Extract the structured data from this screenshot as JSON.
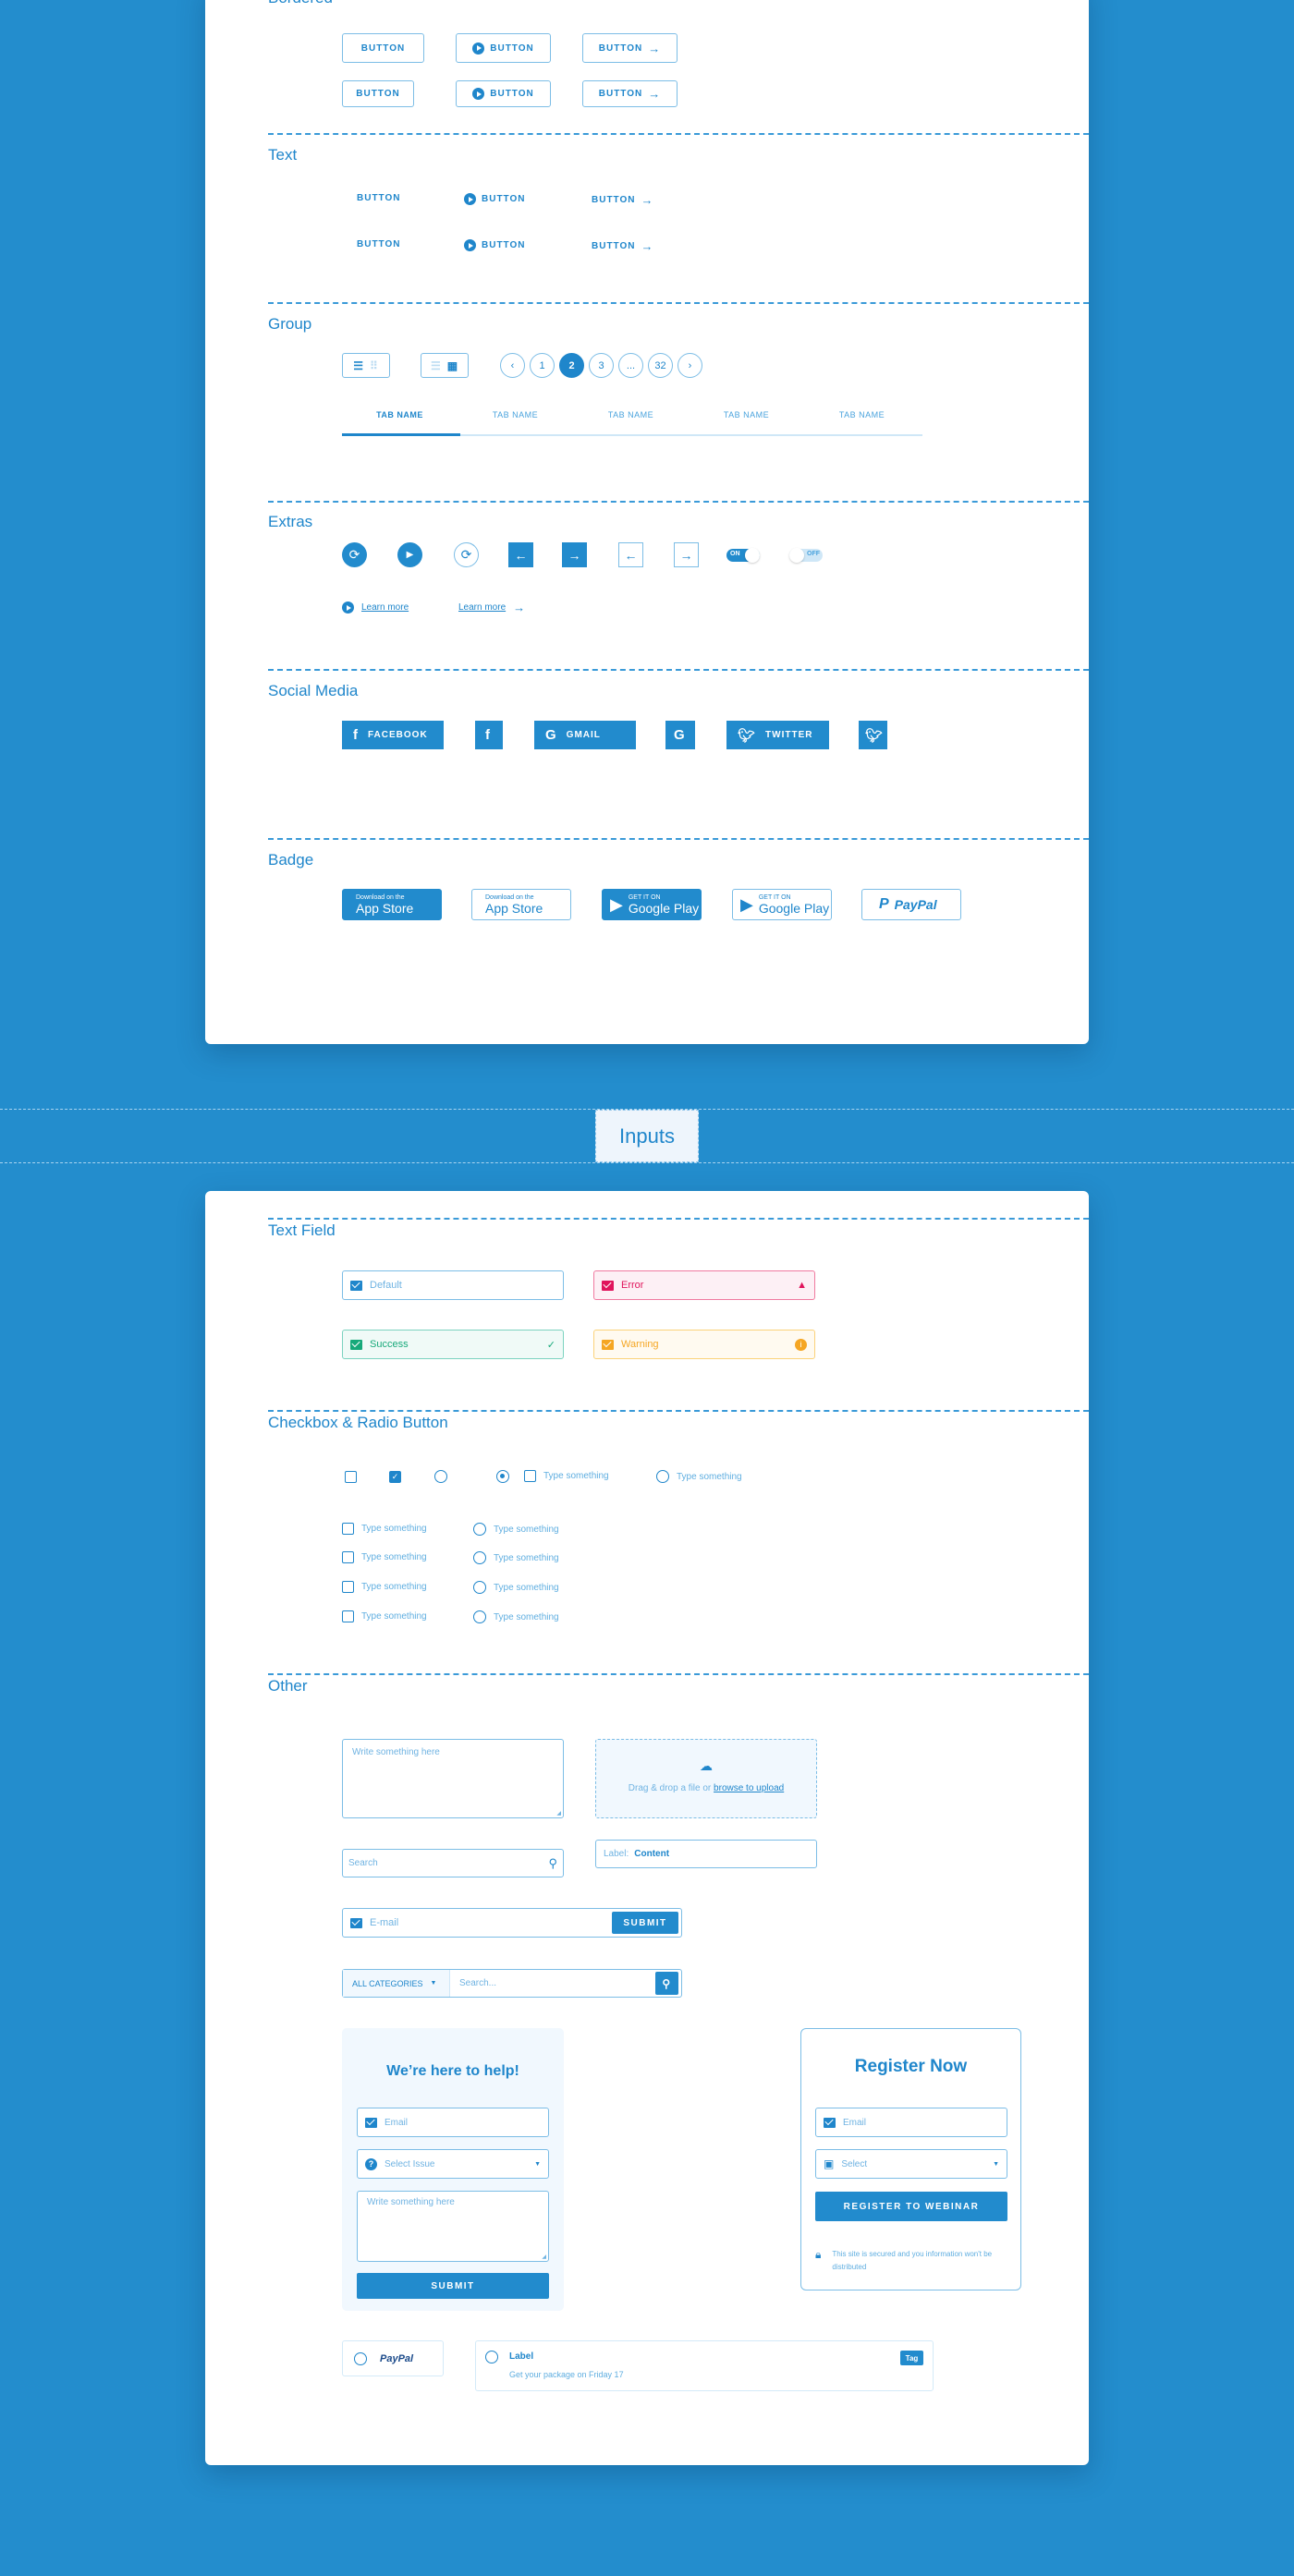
{
  "colors": {
    "background": "#238dcd",
    "primary": "#1f86cb",
    "error": "#e0155c",
    "success": "#17a97a",
    "warning": "#f5a623"
  },
  "sections": {
    "bordered": "Bordered",
    "text": "Text",
    "group": "Group",
    "extras": "Extras",
    "social": "Social Media",
    "badge": "Badge",
    "inputs": "Inputs",
    "text_field": "Text Field",
    "checkbox": "Checkbox & Radio Button",
    "other": "Other"
  },
  "buttons": {
    "label": "BUTTON"
  },
  "pagination": {
    "prev": "‹",
    "pages": [
      "1",
      "2",
      "3",
      "...",
      "32"
    ],
    "current": "2",
    "next": "›"
  },
  "tabs": [
    "TAB NAME",
    "TAB NAME",
    "TAB NAME",
    "TAB NAME",
    "TAB NAME"
  ],
  "extras": {
    "toggle_on": "ON",
    "toggle_off": "OFF",
    "learn_more": "Learn more"
  },
  "social": {
    "facebook": "FACEBOOK",
    "gmail": "GMAIL",
    "twitter": "TWITTER"
  },
  "badges": {
    "appstore_small": "Download on the",
    "appstore_big": "App Store",
    "gplay_small": "GET IT ON",
    "gplay_big": "Google Play",
    "paypal": "PayPal"
  },
  "text_fields": {
    "default": "Default",
    "error": "Error",
    "success": "Success",
    "warning": "Warning"
  },
  "checkbox": {
    "option": "Type something"
  },
  "other": {
    "textarea_placeholder": "Write something here",
    "upload_text": "Drag & drop a file or",
    "upload_link": "browse to upload",
    "search_placeholder": "Search",
    "label": "Label:",
    "content": "Content",
    "email_placeholder": "E-mail",
    "submit": "SUBMIT",
    "categories": "ALL CATEGORIES",
    "search2_placeholder": "Search..."
  },
  "help_form": {
    "title": "We’re here to help!",
    "email": "Email",
    "select": "Select Issue",
    "textarea": "Write something here",
    "submit": "SUBMIT"
  },
  "register_form": {
    "title": "Register Now",
    "email": "Email",
    "select": "Select",
    "button": "REGISTER TO WEBINAR",
    "secure_note": "This site is secured and you information won't be distributed"
  },
  "payment": {
    "paypal": "PayPal",
    "label": "Label",
    "desc": "Get your package on Friday 17",
    "tag": "Tag"
  }
}
